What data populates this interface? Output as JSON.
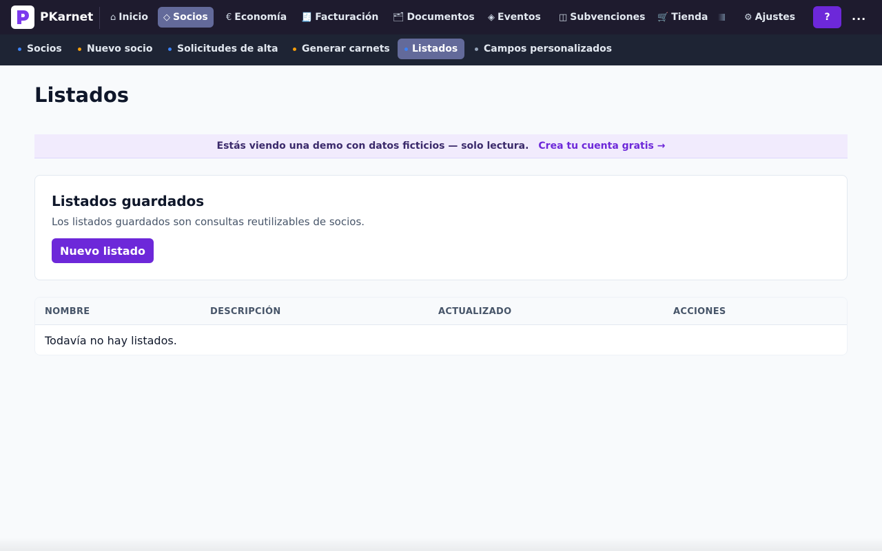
{
  "brand": {
    "name": "PKarnet"
  },
  "topnav": {
    "items": [
      {
        "icon": "⌂",
        "label": "Inicio"
      },
      {
        "icon": "◇",
        "label": "Socios"
      },
      {
        "icon": "€",
        "label": "Economía"
      },
      {
        "icon": "🧾",
        "label": "Facturación"
      },
      {
        "icon": "🗂",
        "label": "Documentos"
      },
      {
        "icon": "◈",
        "label": "Eventos"
      },
      {
        "icon": "◫",
        "label": "Subvenciones"
      },
      {
        "icon": "🛒",
        "label": "Tienda"
      },
      {
        "icon": "⚙",
        "label": "Ajustes"
      }
    ],
    "help_label": "?",
    "more_label": "..."
  },
  "subnav": {
    "items": [
      {
        "label": "Socios",
        "dot_color": "#3b82f6"
      },
      {
        "label": "Nuevo socio",
        "dot_color": "#f59e0b"
      },
      {
        "label": "Solicitudes de alta",
        "dot_color": "#3b82f6"
      },
      {
        "label": "Generar carnets",
        "dot_color": "#f59e0b"
      },
      {
        "label": "Listados",
        "dot_color": "#3b82f6"
      },
      {
        "label": "Campos personalizados",
        "dot_color": "#94a3b8"
      }
    ]
  },
  "page": {
    "title": "Listados"
  },
  "banner": {
    "text": "Estás viendo una demo con datos ficticios — solo lectura.",
    "link": "Crea tu cuenta gratis →"
  },
  "card": {
    "title": "Listados guardados",
    "description": "Los listados guardados son consultas reutilizables de socios.",
    "button": "Nuevo listado"
  },
  "table": {
    "columns": [
      "NOMBRE",
      "DESCRIPCIÓN",
      "ACTUALIZADO",
      "ACCIONES"
    ],
    "empty": "Todavía no hay listados."
  },
  "colors": {
    "accent": "#6d28d9",
    "topbar": "#1e1b2e",
    "subbar": "#1e2434",
    "active_tab": "#636a9a"
  }
}
